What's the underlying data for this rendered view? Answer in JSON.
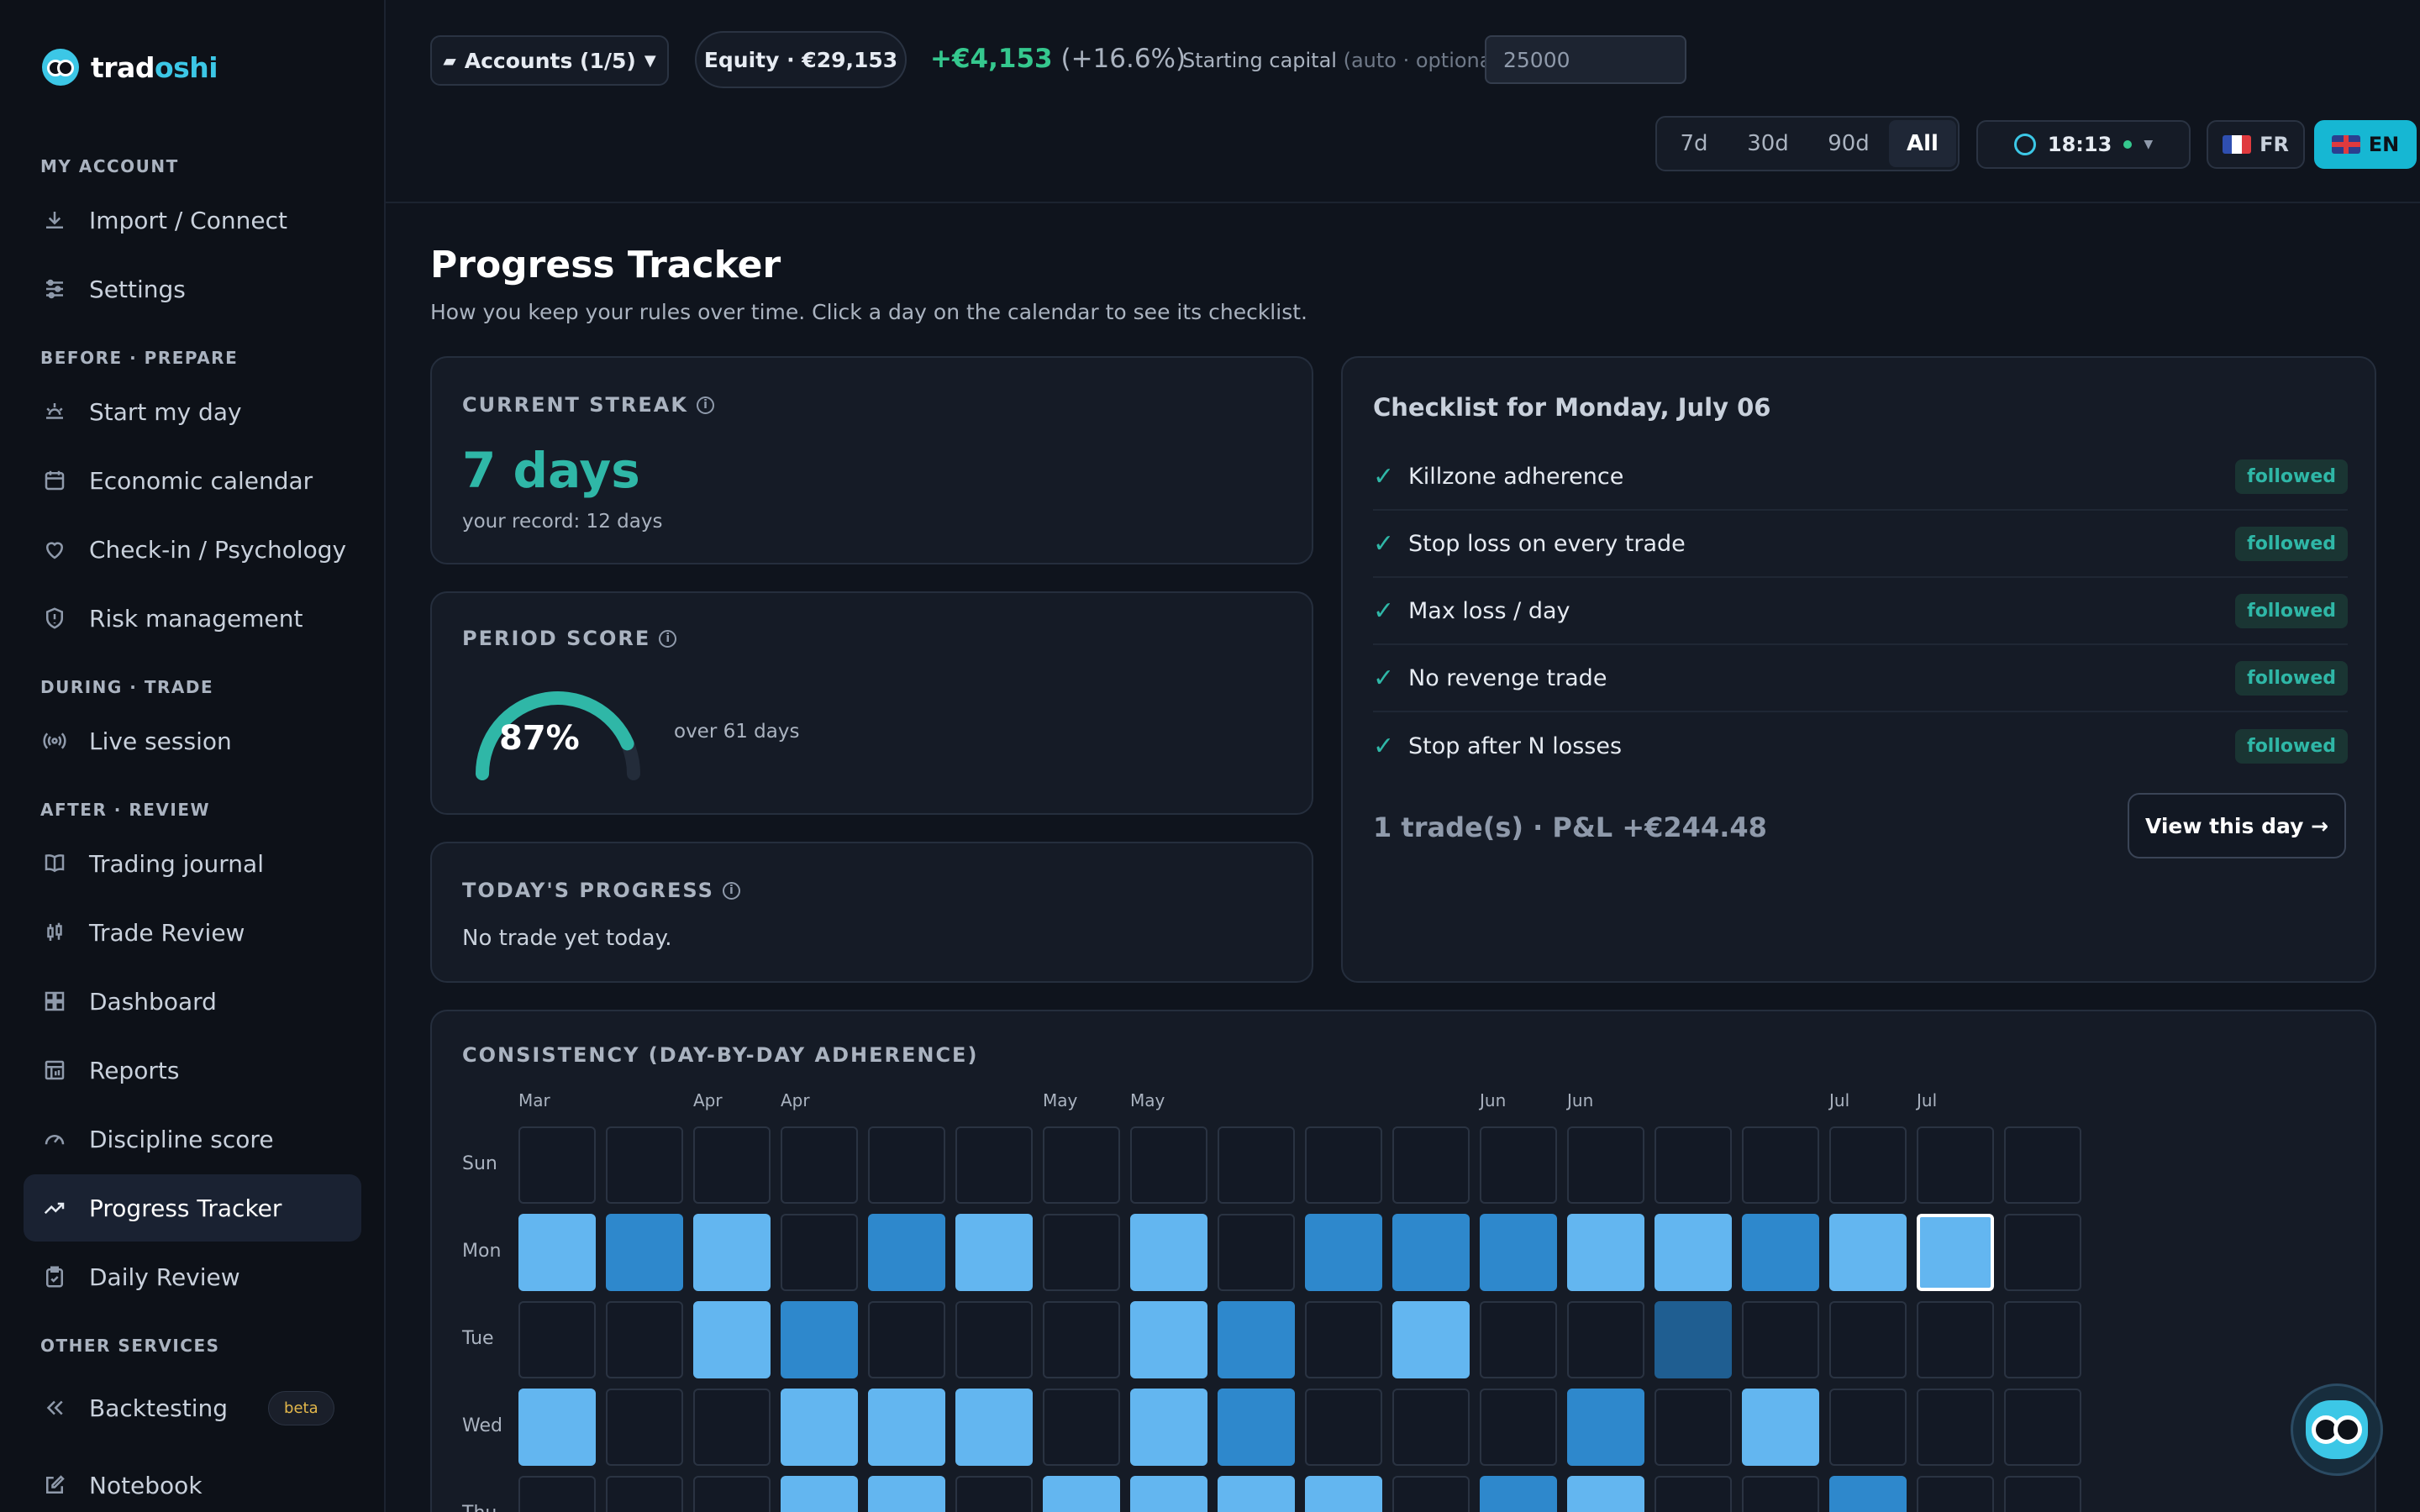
{
  "app": {
    "logo_prefix": "trad",
    "logo_suffix": "oshi"
  },
  "sidebar": {
    "sections": [
      {
        "label": "MY ACCOUNT"
      },
      {
        "label": "BEFORE · PREPARE"
      },
      {
        "label": "DURING · TRADE"
      },
      {
        "label": "AFTER · REVIEW"
      },
      {
        "label": "OTHER SERVICES"
      }
    ],
    "items": [
      {
        "label": "Import / Connect",
        "icon": "download-icon"
      },
      {
        "label": "Settings",
        "icon": "sliders-icon"
      },
      {
        "label": "Start my day",
        "icon": "sunrise-icon"
      },
      {
        "label": "Economic calendar",
        "icon": "calendar-icon"
      },
      {
        "label": "Check-in / Psychology",
        "icon": "heart-icon"
      },
      {
        "label": "Risk management",
        "icon": "shield-icon"
      },
      {
        "label": "Live session",
        "icon": "broadcast-icon"
      },
      {
        "label": "Trading journal",
        "icon": "book-icon"
      },
      {
        "label": "Trade Review",
        "icon": "candlestick-icon"
      },
      {
        "label": "Dashboard",
        "icon": "grid-icon"
      },
      {
        "label": "Reports",
        "icon": "report-icon"
      },
      {
        "label": "Discipline score",
        "icon": "gauge-icon"
      },
      {
        "label": "Progress Tracker",
        "icon": "trend-icon"
      },
      {
        "label": "Daily Review",
        "icon": "clipboard-check-icon"
      },
      {
        "label": "Backtesting",
        "icon": "rewind-icon",
        "badge": "beta"
      },
      {
        "label": "Notebook",
        "icon": "edit-icon"
      }
    ]
  },
  "topbar": {
    "accounts_label": "Accounts (1/5)",
    "equity_label": "Equity · €29,153",
    "pnl_value": "+€4,153",
    "pnl_pct": "(+16.6%)",
    "capital_label": "Starting capital",
    "capital_hint": "(auto · optional)",
    "capital_value": "25000",
    "ranges": [
      "7d",
      "30d",
      "90d",
      "All"
    ],
    "range_selected": "All",
    "clock": "18:13",
    "lang_fr": "FR",
    "lang_en": "EN",
    "colors": {
      "accent": "#16b7d3",
      "positive": "#35c88e"
    }
  },
  "page": {
    "title": "Progress Tracker",
    "subtitle": "How you keep your rules over time. Click a day on the calendar to see its checklist."
  },
  "streak": {
    "heading": "CURRENT STREAK",
    "value": "7 days",
    "record": "your record: 12 days"
  },
  "score": {
    "heading": "PERIOD SCORE",
    "percent": 87,
    "value_label": "87%",
    "note": "over 61 days"
  },
  "today": {
    "heading": "TODAY'S PROGRESS",
    "text": "No trade yet today."
  },
  "checklist": {
    "title": "Checklist for Monday, July 06",
    "items": [
      {
        "rule": "Killzone adherence",
        "status": "followed"
      },
      {
        "rule": "Stop loss on every trade",
        "status": "followed"
      },
      {
        "rule": "Max loss / day",
        "status": "followed"
      },
      {
        "rule": "No revenge trade",
        "status": "followed"
      },
      {
        "rule": "Stop after N losses",
        "status": "followed"
      }
    ],
    "summary": "1 trade(s) · P&L +€244.48",
    "view_button": "View this day →"
  },
  "consistency": {
    "heading": "CONSISTENCY (DAY-BY-DAY ADHERENCE)",
    "months": [
      {
        "col": 0,
        "label": "Mar"
      },
      {
        "col": 2,
        "label": "Apr"
      },
      {
        "col": 3,
        "label": "Apr"
      },
      {
        "col": 6,
        "label": "May"
      },
      {
        "col": 7,
        "label": "May"
      },
      {
        "col": 11,
        "label": "Jun"
      },
      {
        "col": 12,
        "label": "Jun"
      },
      {
        "col": 15,
        "label": "Jul"
      },
      {
        "col": 16,
        "label": "Jul"
      }
    ],
    "days": [
      "Sun",
      "Mon",
      "Tue",
      "Wed",
      "Thu"
    ],
    "levels": [
      [
        0,
        0,
        0,
        0,
        0,
        0,
        0,
        0,
        0,
        0,
        0,
        0,
        0,
        0,
        0,
        0,
        0,
        0
      ],
      [
        1,
        2,
        1,
        0,
        2,
        1,
        0,
        1,
        0,
        2,
        2,
        2,
        1,
        1,
        2,
        1,
        1,
        0
      ],
      [
        0,
        0,
        1,
        2,
        0,
        0,
        0,
        1,
        2,
        0,
        1,
        0,
        0,
        3,
        0,
        0,
        0,
        0
      ],
      [
        1,
        0,
        0,
        1,
        1,
        1,
        0,
        1,
        2,
        0,
        0,
        0,
        2,
        0,
        1,
        0,
        0,
        0
      ],
      [
        0,
        0,
        0,
        1,
        1,
        0,
        1,
        1,
        1,
        1,
        0,
        2,
        1,
        0,
        0,
        2,
        0,
        0
      ]
    ],
    "selected": {
      "row": 1,
      "col": 16
    }
  }
}
